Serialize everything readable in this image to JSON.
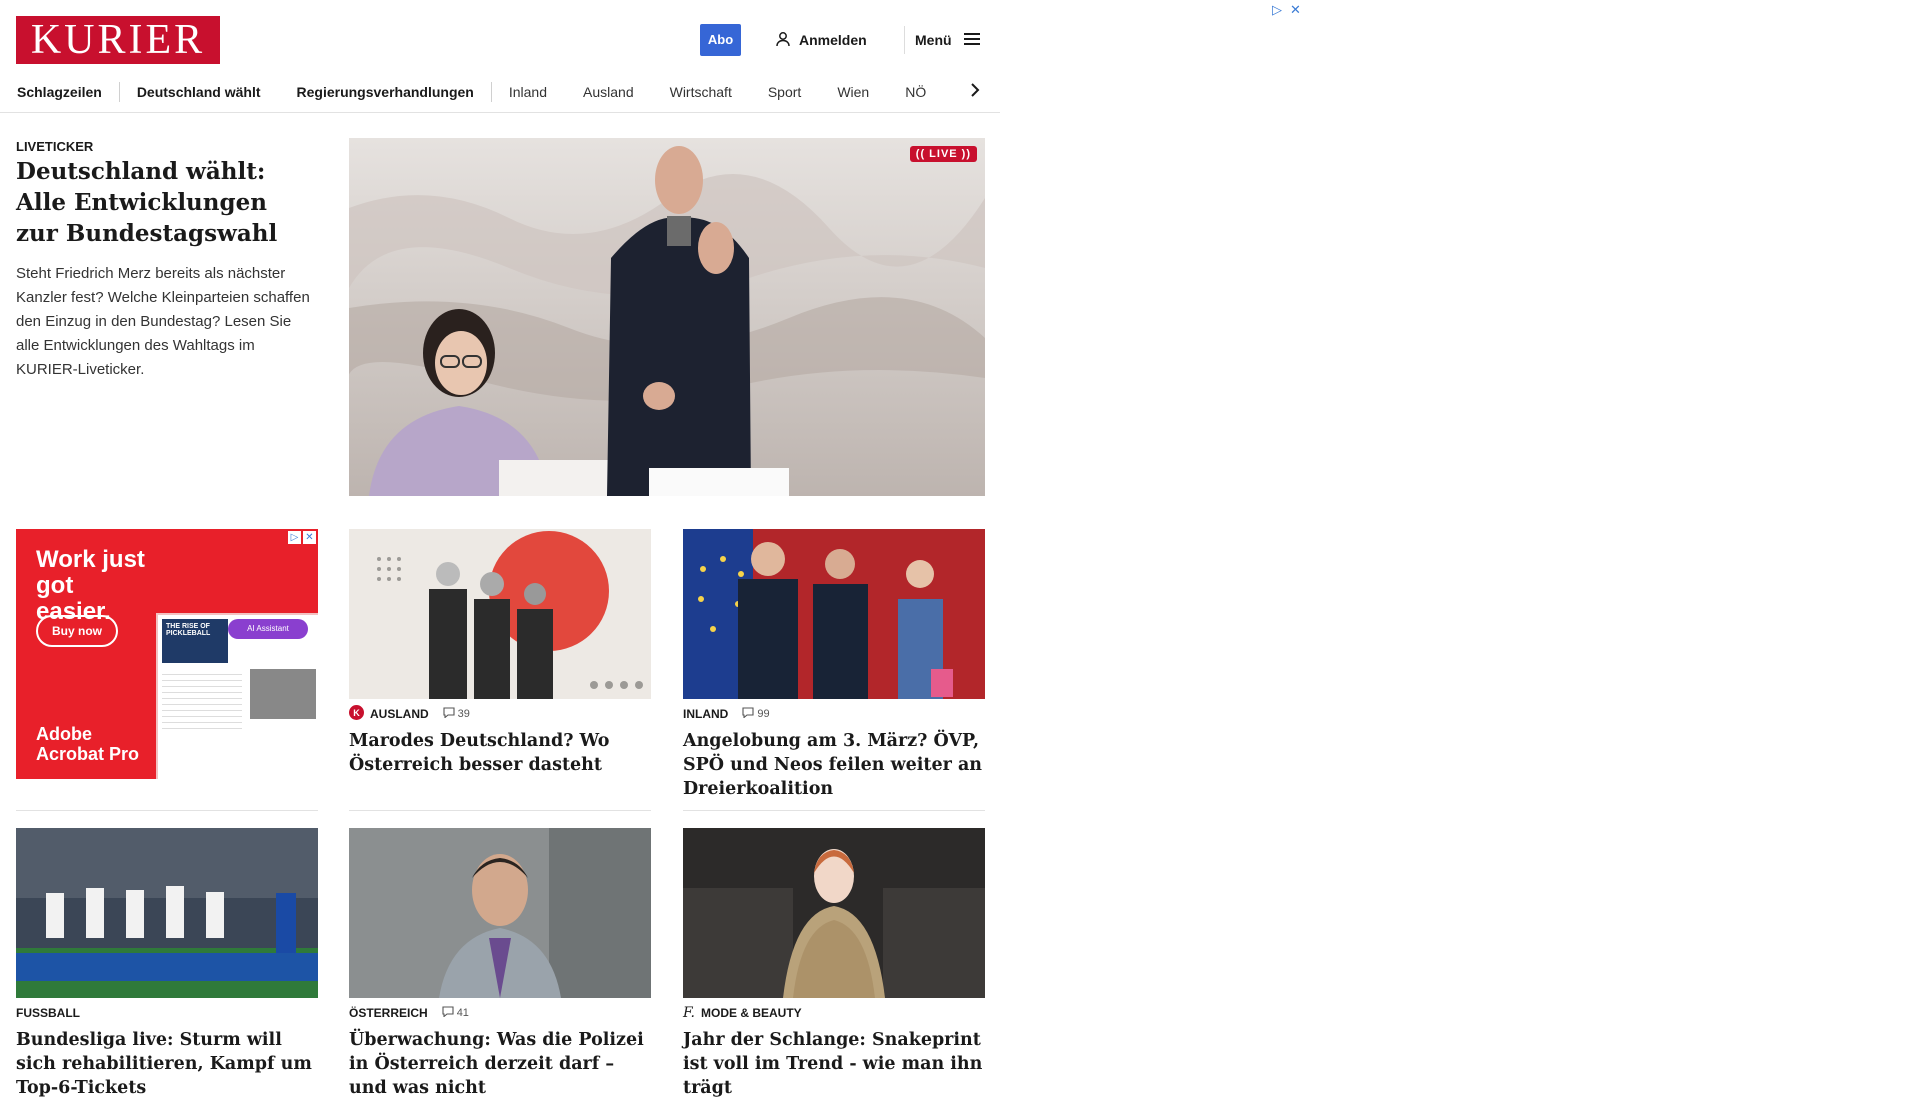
{
  "header": {
    "logo": "KURIER",
    "abo_label": "Abo",
    "login_label": "Anmelden",
    "menu_label": "Menü"
  },
  "nav": {
    "items": [
      "Schlagzeilen",
      "Deutschland wählt",
      "Regierungsverhandlungen",
      "Inland",
      "Ausland",
      "Wirtschaft",
      "Sport",
      "Wien",
      "NÖ"
    ],
    "next_icon": "chevron-right-icon"
  },
  "hero": {
    "kicker": "LIVETICKER",
    "title": "Deutschland wählt: Alle Entwicklungen zur Bundestagswahl",
    "teaser": "Steht Friedrich Merz bereits als nächster Kanzler fest? Welche Kleinparteien schaffen den Einzug in den Bundestag? Lesen Sie alle Entwicklungen des Wahltags im KURIER-Liveticker.",
    "live_badge": "(( LIVE ))"
  },
  "ad": {
    "headline": "Work just got easier.",
    "button": "Buy now",
    "brand": "Adobe Acrobat Pro",
    "mock_title": "THE RISE OF PICKLEBALL",
    "pill": "AI Assistant"
  },
  "cards": [
    {
      "category": "AUSLAND",
      "comments": "39",
      "title": "Marodes Deutschland? Wo Österreich besser dasteht",
      "icon": "kurier-k-icon"
    },
    {
      "category": "INLAND",
      "comments": "99",
      "title": "Angelobung am 3. März? ÖVP, SPÖ und Neos feilen weiter an Dreierkoalition"
    },
    {
      "category": "FUSSBALL",
      "title": "Bundesliga live: Sturm will sich rehabilitieren, Kampf um Top-6-Tickets"
    },
    {
      "category": "ÖSTERREICH",
      "comments": "41",
      "title": "Überwachung: Was die Polizei in Österreich derzeit darf – und was nicht"
    },
    {
      "category": "MODE & BEAUTY",
      "title": "Jahr der Schlange: Snakeprint ist voll im Trend - wie man ihn trägt",
      "icon": "freizeit-f-icon"
    }
  ],
  "colors": {
    "brand": "#c8102e",
    "abo": "#3666d6"
  }
}
